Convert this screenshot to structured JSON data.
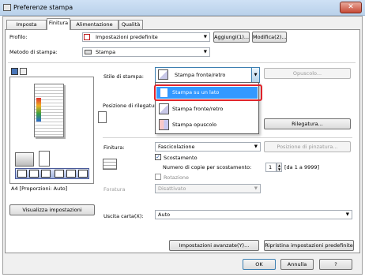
{
  "window": {
    "title": "Preferenze stampa",
    "close_glyph": "✕"
  },
  "tabs": [
    {
      "label": "Imposta pagina"
    },
    {
      "label": "Finitura"
    },
    {
      "label": "Alimentazione carta"
    },
    {
      "label": "Qualità"
    }
  ],
  "profile": {
    "label": "Profilo:",
    "value": "Impostazioni predefinite",
    "add_button": "Aggiungi(1)...",
    "edit_button": "Modifica(2)..."
  },
  "print_method": {
    "label": "Metodo di stampa:",
    "value": "Stampa"
  },
  "preview": {
    "paper_label": "A4 [Proporzioni: Auto]",
    "view_settings_button": "Visualizza impostazioni"
  },
  "print_style": {
    "label": "Stile di stampa:",
    "value": "Stampa fronte/retro",
    "booklet_button": "Opuscolo...",
    "options": [
      {
        "label": "Stampa su un lato",
        "icon": "single-sided-icon"
      },
      {
        "label": "Stampa fronte/retro",
        "icon": "duplex-icon"
      },
      {
        "label": "Stampa opuscolo",
        "icon": "booklet-icon"
      }
    ]
  },
  "binding": {
    "label": "Posizione di rilegatura:",
    "binding_button": "Rilegatura..."
  },
  "finishing": {
    "label": "Finitura:",
    "value": "Fascicolazione",
    "staple_position_button": "Posizione di pinzatura...",
    "offset_label": "Scostamento",
    "offset_checked": true,
    "copies_label": "Numero di copie per scostamento:",
    "copies_value": "1",
    "copies_range": "[da 1 a 9999]",
    "rotation_label": "Rotazione",
    "rotation_checked": false,
    "punch_label": "Foratura",
    "punch_value": "Disattivato"
  },
  "output": {
    "label": "Uscita carta(X):",
    "value": "Auto"
  },
  "footer": {
    "advanced_button": "Impostazioni avanzate(Y)...",
    "restore_button": "Ripristina impostazioni predefinite",
    "ok": "OK",
    "cancel": "Annulla",
    "help": "?"
  },
  "colors": {
    "highlight": "#3399ff",
    "callout": "#e0232a",
    "title_bar": "#c4daf1"
  }
}
